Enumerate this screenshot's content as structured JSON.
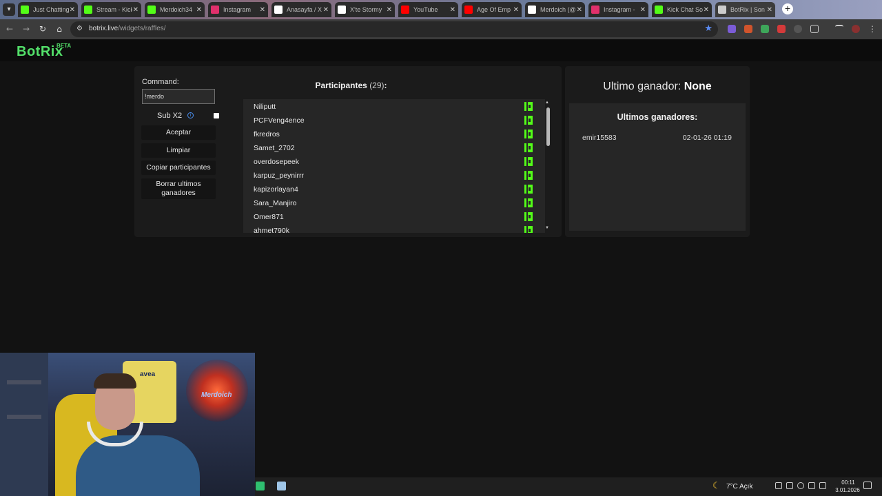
{
  "browser": {
    "tabs": [
      {
        "label": "Just Chatting",
        "icon": "kick-icon",
        "color": "#53fc18"
      },
      {
        "label": "Stream - Kick",
        "icon": "kick-icon",
        "color": "#53fc18"
      },
      {
        "label": "Merdoich34",
        "icon": "kick-icon",
        "color": "#53fc18"
      },
      {
        "label": "Instagram",
        "icon": "instagram-icon",
        "color": "#e1306c"
      },
      {
        "label": "Anasayfa / X",
        "icon": "x-icon",
        "color": "#ffffff"
      },
      {
        "label": "X'te Stormy",
        "icon": "x-icon",
        "color": "#ffffff"
      },
      {
        "label": "YouTube",
        "icon": "youtube-icon",
        "color": "#ff0000"
      },
      {
        "label": "Age Of Emp",
        "icon": "youtube-icon",
        "color": "#ff0000"
      },
      {
        "label": "Merdoich (@",
        "icon": "tiktok-icon",
        "color": "#ffffff"
      },
      {
        "label": "Instagram -",
        "icon": "instagram-icon",
        "color": "#e1306c"
      },
      {
        "label": "Kick Chat So",
        "icon": "kick-chat-icon",
        "color": "#53fc18"
      },
      {
        "label": "BotRix | Son",
        "icon": "botrix-icon",
        "color": "#cccccc"
      }
    ],
    "url_host": "botrix.live",
    "url_path": "/widgets/raffles/"
  },
  "site": {
    "logo": "BotRix",
    "beta": "BETA"
  },
  "raffle": {
    "command_label": "Command:",
    "command_value": "!merdo",
    "subx2_label": "Sub X2",
    "info_glyph": "i",
    "buttons": {
      "accept": "Aceptar",
      "clear": "Limpiar",
      "copy": "Copiar participantes",
      "delete_winners": "Borrar ultimos ganadores"
    },
    "participants_title": "Participantes",
    "participants_count": "(29)",
    "participants_colon": ":",
    "participants": [
      "Niliputt",
      "PCFVeng4ence",
      "fkredros",
      "Samet_2702",
      "overdosepeek",
      "karpuz_peynirrr",
      "kapizorlayan4",
      "Sara_Manjiro",
      "Omer871",
      "ahmet790k"
    ]
  },
  "winners": {
    "last_winner_label": "Ultimo ganador:",
    "last_winner_value": "None",
    "title": "Ultimos ganadores:",
    "list": [
      {
        "name": "emir15583",
        "time": "02-01-26 01:19"
      }
    ]
  },
  "webcam": {
    "jersey_text": "avea",
    "neon_text": "Merdoich"
  },
  "taskbar": {
    "weather": "7°C  Açık",
    "time": "00:11",
    "date": "3.01.2026"
  },
  "colors": {
    "accent": "#53e06a",
    "kick_green": "#53fc18",
    "panel": "#1b1b1b",
    "list_bg": "#262626"
  }
}
